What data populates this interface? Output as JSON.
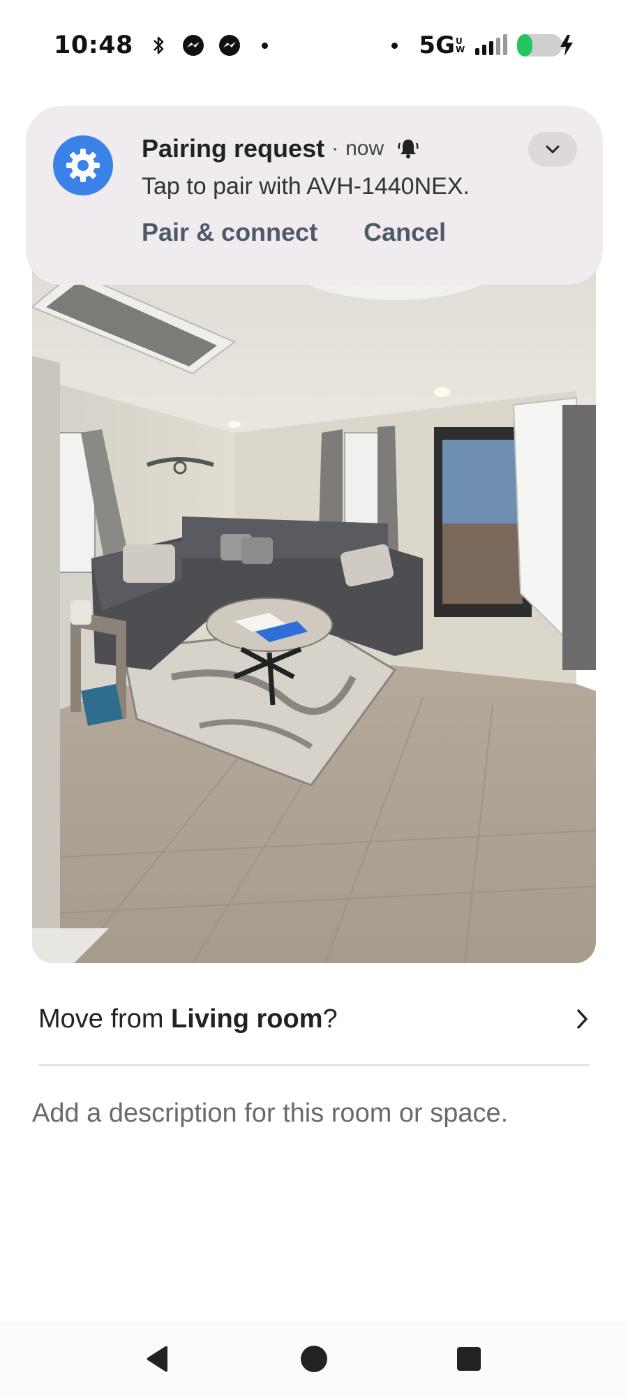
{
  "status_bar": {
    "time": "10:48",
    "left_icons": [
      "bluetooth-icon",
      "messenger-icon",
      "messenger-icon",
      "notification-dot-icon"
    ],
    "network": "5G",
    "network_sub": "UW",
    "right_icons": [
      "notification-dot-icon",
      "signal-icon",
      "battery-charging-icon"
    ],
    "battery_level": 0.3
  },
  "notification": {
    "app_icon": "settings-gear-icon",
    "title": "Pairing request",
    "separator": "·",
    "time": "now",
    "bell_icon": "alert-bell-icon",
    "text": "Tap to pair with AVH-1440NEX.",
    "actions": {
      "pair": "Pair & connect",
      "cancel": "Cancel"
    },
    "expand_icon": "chevron-down-icon"
  },
  "room": {
    "photo": "living-room-photo",
    "move_prefix": "Move from ",
    "room_name": "Living room",
    "move_suffix": "?",
    "chevron_icon": "chevron-right-icon",
    "description_placeholder": "Add a description for this room or space."
  },
  "nav_bar": {
    "back_icon": "back-triangle-icon",
    "home_icon": "home-circle-icon",
    "recents_icon": "recents-square-icon"
  },
  "colors": {
    "notification_bg": "#efebee",
    "app_icon_bg": "#3b82e8",
    "battery_green": "#22c55e",
    "action_text": "#4e5968"
  }
}
